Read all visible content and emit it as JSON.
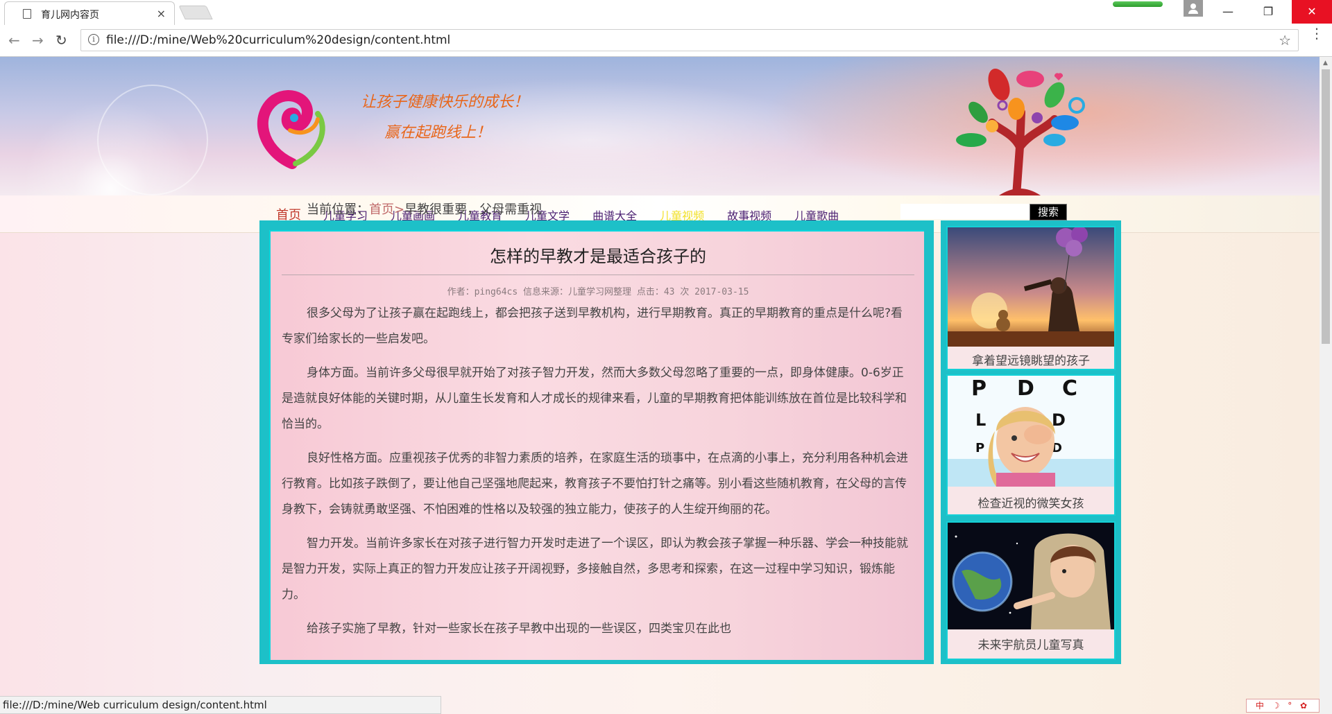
{
  "browser": {
    "tab_title": "育儿网内容页",
    "tab_close": "×",
    "url": "file:///D:/mine/Web%20curriculum%20design/content.html",
    "window_controls": {
      "minimize": "—",
      "maximize": "❐",
      "close": "✕"
    },
    "nav": {
      "back": "←",
      "forward": "→",
      "reload": "↻",
      "bookmark": "☆",
      "info": "i",
      "menu": "⋮"
    }
  },
  "banner": {
    "slogan_line1": "让孩子健康快乐的成长！",
    "slogan_line2": "赢在起跑线上！",
    "slogan_color": "#e8661a"
  },
  "nav": {
    "items": [
      {
        "label": "首页"
      },
      {
        "label": "儿童学习"
      },
      {
        "label": "儿童画画"
      },
      {
        "label": "儿童教育"
      },
      {
        "label": "儿童文学"
      },
      {
        "label": "曲谱大全"
      },
      {
        "label": "儿童视频"
      },
      {
        "label": "故事视频"
      },
      {
        "label": "儿童歌曲"
      }
    ],
    "active_index": 6,
    "search_placeholder": "",
    "search_button": "搜索"
  },
  "breadcrumb": {
    "prefix": "当前位置：",
    "home": "首页",
    "separator": ">",
    "current": "早教很重要，父母需重视"
  },
  "article": {
    "title": "怎样的早教才是最适合孩子的",
    "meta": "作者：ping64cs 信息来源：儿童学习网整理 点击：43 次 2017-03-15",
    "paragraphs": [
      "很多父母为了让孩子赢在起跑线上，都会把孩子送到早教机构，进行早期教育。真正的早期教育的重点是什么呢?看专家们给家长的一些启发吧。",
      "身体方面。当前许多父母很早就开始了对孩子智力开发，然而大多数父母忽略了重要的一点，即身体健康。0-6岁正是造就良好体能的关键时期，从儿童生长发育和人才成长的规律来看，儿童的早期教育把体能训练放在首位是比较科学和恰当的。",
      "良好性格方面。应重视孩子优秀的非智力素质的培养，在家庭生活的琐事中，在点滴的小事上，充分利用各种机会进行教育。比如孩子跌倒了，要让他自己坚强地爬起来，教育孩子不要怕打针之痛等。别小看这些随机教育，在父母的言传身教下，会铸就勇敢坚强、不怕困难的性格以及较强的独立能力，使孩子的人生绽开绚丽的花。",
      "智力开发。当前许多家长在对孩子进行智力开发时走进了一个误区，即认为教会孩子掌握一种乐器、学会一种技能就是智力开发，实际上真正的智力开发应让孩子开阔视野，多接触自然，多思考和探索，在这一过程中学习知识，锻炼能力。",
      "给孩子实施了早教，针对一些家长在孩子早教中出现的一些误区，四类宝贝在此也"
    ]
  },
  "sidebar": {
    "cards": [
      {
        "caption": "拿着望远镜眺望的孩子"
      },
      {
        "caption": "检查近视的微笑女孩"
      },
      {
        "caption": "未来宇航员儿童写真"
      }
    ],
    "eye_chart_letters": [
      "P",
      "D",
      "C",
      "L",
      "D",
      "P",
      "D"
    ]
  },
  "status_bar": {
    "text": "file:///D:/mine/Web curriculum design/content.html"
  },
  "ime": {
    "text": "中 ☽ ° ✿"
  },
  "colors": {
    "frame_cyan": "#1dc0c8",
    "nav_text": "#4a1f72",
    "nav_active": "#f2e12a",
    "home_link": "#c06a6a"
  }
}
